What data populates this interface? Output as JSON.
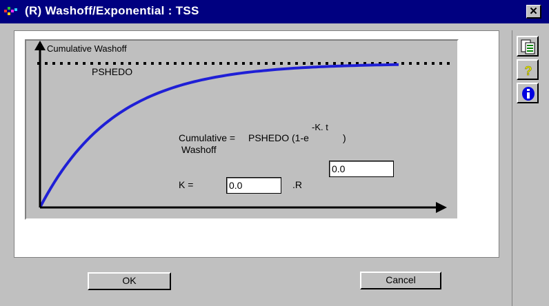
{
  "window": {
    "title": "(R) Washoff/Exponential : TSS",
    "close_glyph": "✕"
  },
  "graph": {
    "y_axis_label": "Cumulative Washoff",
    "asymptote_label": "PSHEDO",
    "formula_lhs": "Cumulative =",
    "formula_rhs": "PSHEDO (1-e",
    "formula_exponent": "-K. t",
    "formula_close": ")",
    "formula_lhs_line2": "Washoff",
    "k_label": "K =",
    "k_value": "0.0",
    "k_unit": ".R",
    "r_value": "0.0",
    "curve_color": "#1f1fd6"
  },
  "buttons": {
    "ok": "OK",
    "cancel": "Cancel"
  },
  "toolbar": {
    "items": [
      "copy-pages-icon",
      "help-question-icon",
      "info-icon"
    ]
  }
}
